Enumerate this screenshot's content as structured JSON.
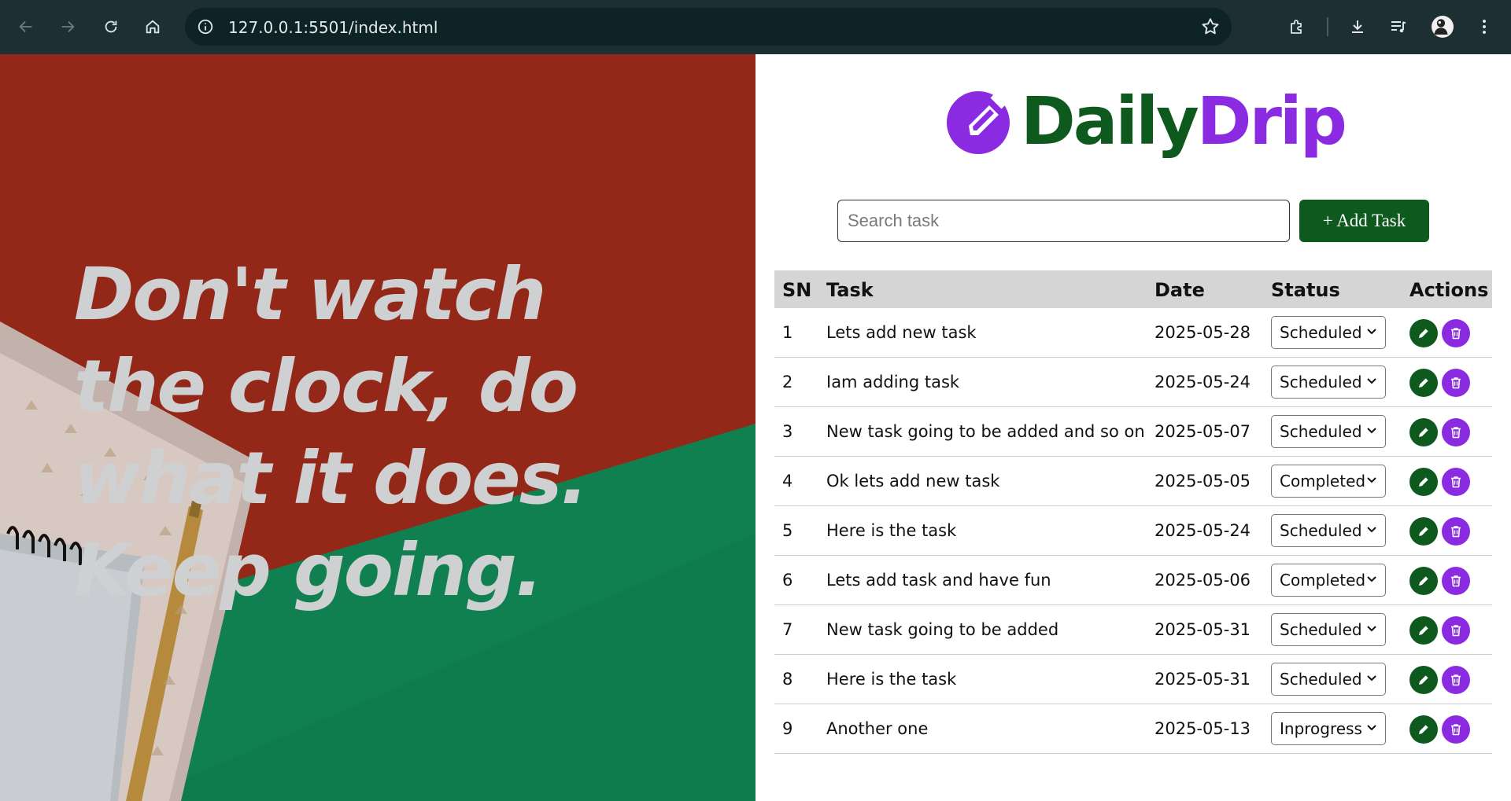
{
  "browser": {
    "url": "127.0.0.1:5501/index.html"
  },
  "hero": {
    "quote": "Don't watch the clock, do what it does. Keep going."
  },
  "logo": {
    "part1": "Daily",
    "part2": "Drip",
    "icon": "pencil-circle-icon"
  },
  "search": {
    "placeholder": "Search task"
  },
  "add_button": {
    "label": "+ Add Task"
  },
  "table": {
    "headers": {
      "sn": "SN",
      "task": "Task",
      "date": "Date",
      "status": "Status",
      "actions": "Actions"
    },
    "rows": [
      {
        "sn": "1",
        "task": "Lets add new task",
        "date": "2025-05-28",
        "status": "Scheduled"
      },
      {
        "sn": "2",
        "task": "Iam adding task",
        "date": "2025-05-24",
        "status": "Scheduled"
      },
      {
        "sn": "3",
        "task": "New task going to be added and so on",
        "date": "2025-05-07",
        "status": "Scheduled"
      },
      {
        "sn": "4",
        "task": "Ok lets add new task",
        "date": "2025-05-05",
        "status": "Completed"
      },
      {
        "sn": "5",
        "task": "Here is the task",
        "date": "2025-05-24",
        "status": "Scheduled"
      },
      {
        "sn": "6",
        "task": "Lets add task and have fun",
        "date": "2025-05-06",
        "status": "Completed"
      },
      {
        "sn": "7",
        "task": "New task going to be added",
        "date": "2025-05-31",
        "status": "Scheduled"
      },
      {
        "sn": "8",
        "task": "Here is the task",
        "date": "2025-05-31",
        "status": "Scheduled"
      },
      {
        "sn": "9",
        "task": "Another one",
        "date": "2025-05-13",
        "status": "Inprogress"
      }
    ]
  },
  "colors": {
    "brand_green": "#0e5a1e",
    "brand_purple": "#8a2be2",
    "header_bg": "#d5d5d5"
  }
}
